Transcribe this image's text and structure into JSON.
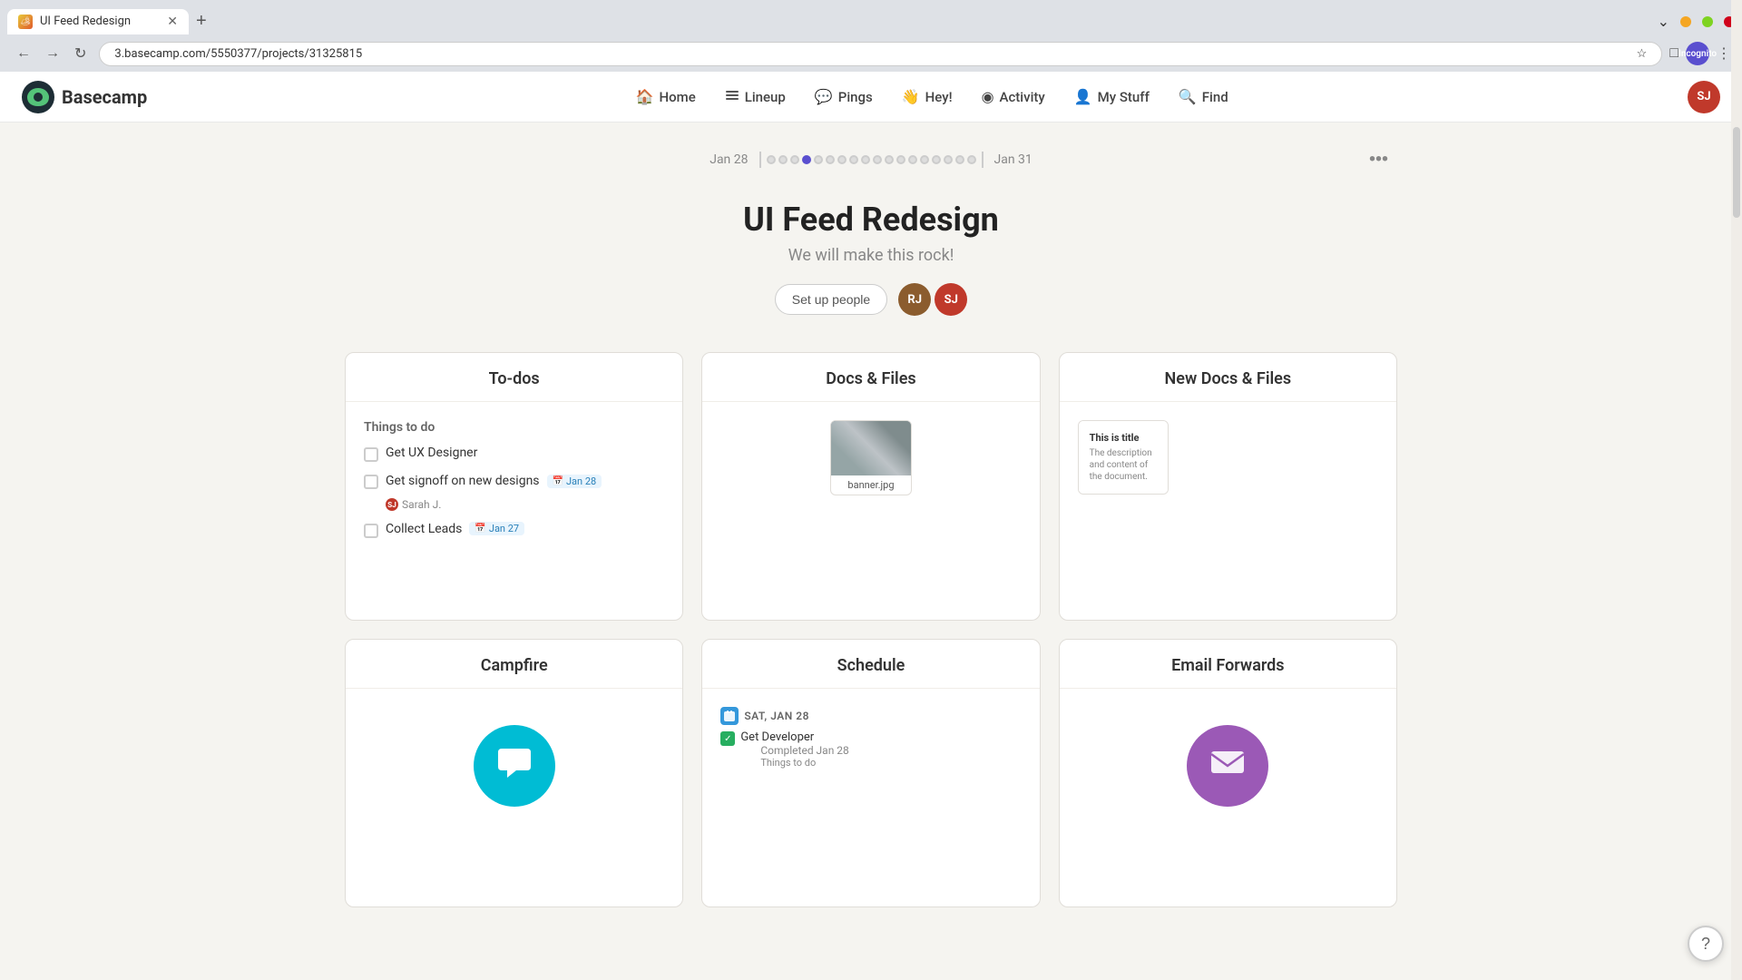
{
  "browser": {
    "tab": {
      "title": "UI Feed Redesign",
      "favicon_text": "B",
      "close": "✕"
    },
    "new_tab_label": "+",
    "controls": {
      "minimize": "─",
      "maximize": "□",
      "close": "✕"
    },
    "nav": {
      "back": "←",
      "forward": "→",
      "reload": "↻",
      "url": "3.basecamp.com/5550377/projects/31325815",
      "star": "☆",
      "extensions": "□",
      "profile_label": "Incognito",
      "more": "⋮"
    }
  },
  "app_nav": {
    "brand": "Basecamp",
    "links": [
      {
        "label": "Home",
        "icon": "🏠"
      },
      {
        "label": "Lineup",
        "icon": "≡"
      },
      {
        "label": "Pings",
        "icon": "💬"
      },
      {
        "label": "Hey!",
        "icon": "👋"
      },
      {
        "label": "Activity",
        "icon": "◉"
      },
      {
        "label": "My Stuff",
        "icon": "👤"
      },
      {
        "label": "Find",
        "icon": "🔍"
      }
    ],
    "user_initials": "SJ"
  },
  "timeline": {
    "start_date": "Jan 28",
    "end_date": "Jan 31",
    "dots_count": 18,
    "active_dot": 3,
    "more_icon": "•••"
  },
  "project": {
    "title": "UI Feed Redesign",
    "subtitle": "We will make this rock!",
    "setup_people_label": "Set up people",
    "avatars": [
      {
        "initials": "RJ",
        "color": "rj"
      },
      {
        "initials": "SJ",
        "color": "sj"
      }
    ]
  },
  "cards": {
    "todos": {
      "title": "To-dos",
      "section_title": "Things to do",
      "items": [
        {
          "label": "Get UX Designer",
          "checked": false,
          "date": null,
          "assignee": null
        },
        {
          "label": "Get signoff on new designs",
          "checked": false,
          "date": "Jan 28",
          "assignee": "Sarah J."
        },
        {
          "label": "Collect Leads",
          "checked": false,
          "date": "Jan 27",
          "assignee": null
        }
      ]
    },
    "docs_files": {
      "title": "Docs & Files",
      "file": {
        "name": "banner.jpg"
      }
    },
    "new_docs": {
      "title": "New Docs & Files",
      "doc": {
        "title_text": "This is title",
        "description": "The description and content of the document."
      }
    },
    "campfire": {
      "title": "Campfire"
    },
    "schedule": {
      "title": "Schedule",
      "events": [
        {
          "date_label": "SAT, JAN 28",
          "tasks": [
            {
              "label": "Get Developer",
              "completed": true,
              "sub": "Completed Jan 28",
              "section": "Things to do"
            }
          ]
        }
      ]
    },
    "email_forwards": {
      "title": "Email Forwards"
    }
  },
  "help_icon": "?",
  "checkbox_check": "✓"
}
